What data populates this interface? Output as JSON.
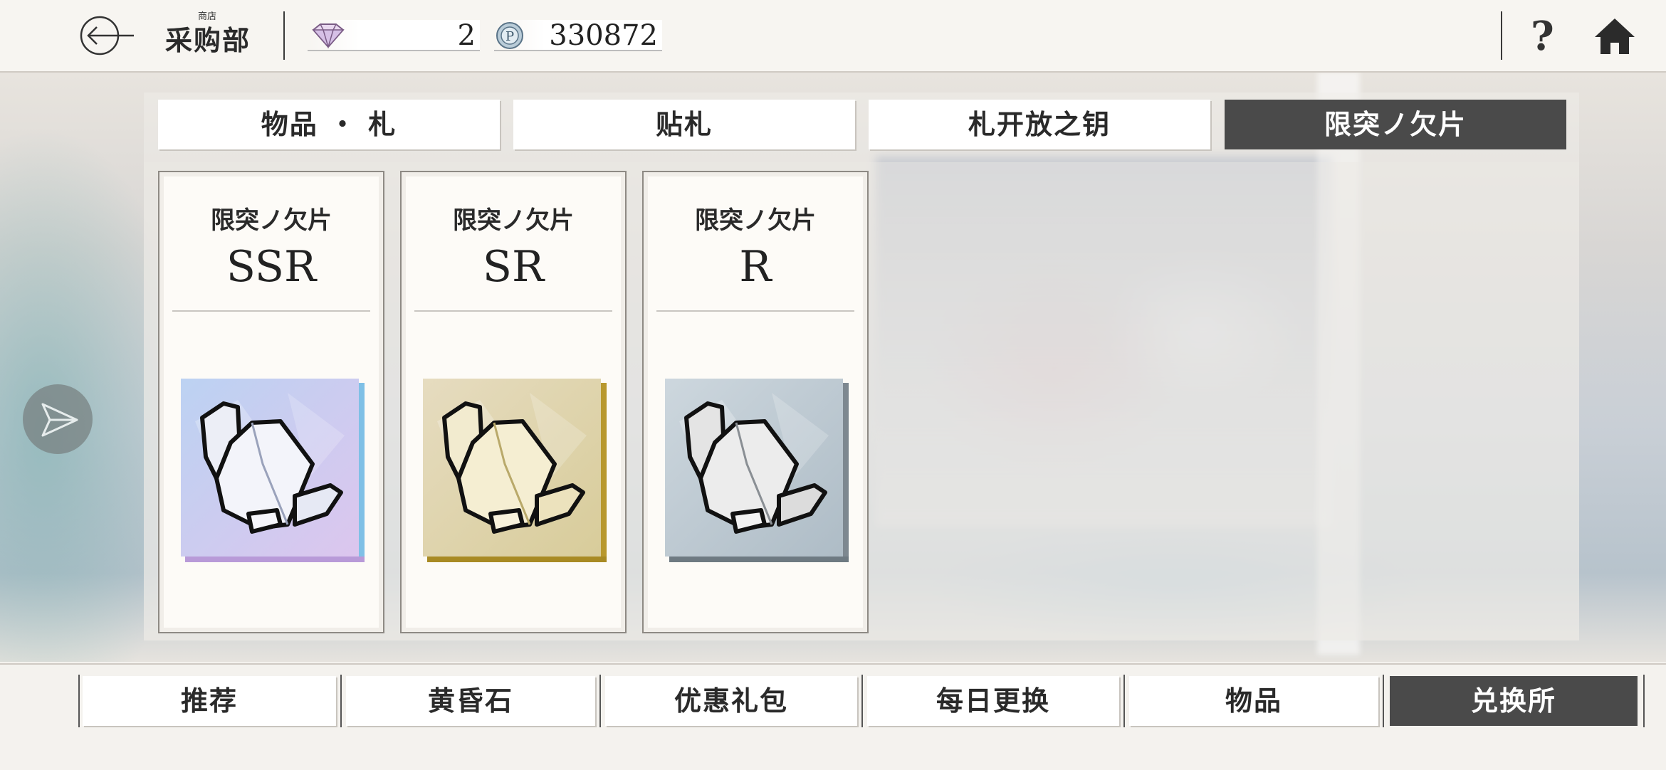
{
  "header": {
    "title_small": "商店",
    "title": "采购部",
    "currencies": [
      {
        "icon": "diamond-icon",
        "value": "2"
      },
      {
        "icon": "p-coin-icon",
        "value": "330872"
      }
    ],
    "help_label": "?"
  },
  "category_tabs": [
    {
      "label": "物品 ・ 札",
      "active": false
    },
    {
      "label": "贴札",
      "active": false
    },
    {
      "label": "札开放之钥",
      "active": false
    },
    {
      "label": "限突ノ欠片",
      "active": true
    }
  ],
  "items": [
    {
      "name": "限突ノ欠片",
      "rarity": "SSR",
      "icon": "crystal-ssr-icon",
      "colors": [
        "#c8d8f0",
        "#d9c8ec"
      ]
    },
    {
      "name": "限突ノ欠片",
      "rarity": "SR",
      "icon": "crystal-sr-icon",
      "colors": [
        "#efe6c8",
        "#c9b56a"
      ]
    },
    {
      "name": "限突ノ欠片",
      "rarity": "R",
      "icon": "crystal-r-icon",
      "colors": [
        "#c9d4dc",
        "#8e9ba4"
      ]
    }
  ],
  "bottom_tabs": [
    {
      "label": "推荐",
      "active": false
    },
    {
      "label": "黄昏石",
      "active": false
    },
    {
      "label": "优惠礼包",
      "active": false
    },
    {
      "label": "每日更换",
      "active": false
    },
    {
      "label": "物品",
      "active": false
    },
    {
      "label": "兑换所",
      "active": true
    }
  ]
}
